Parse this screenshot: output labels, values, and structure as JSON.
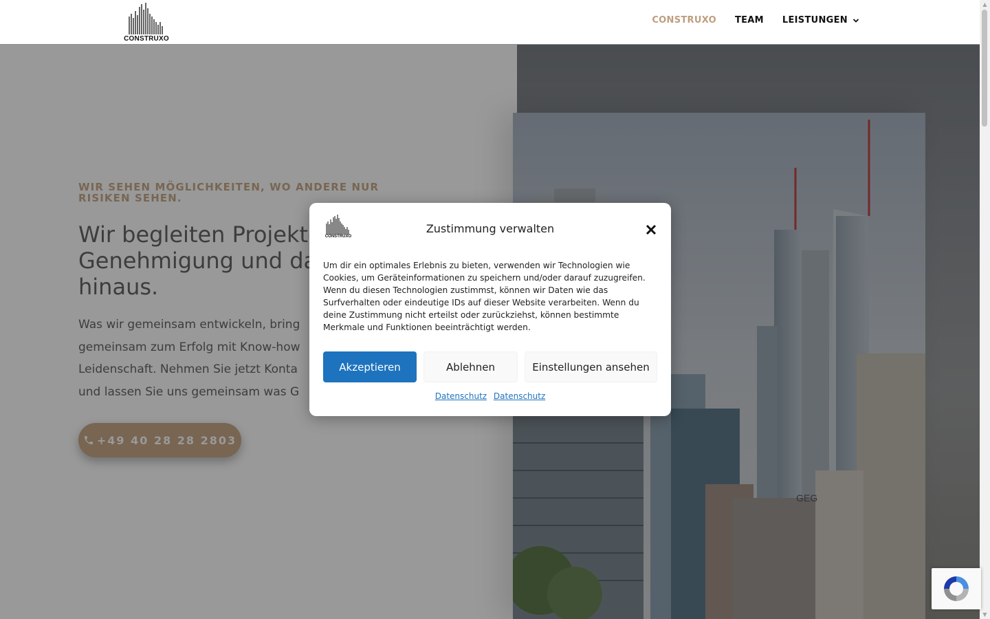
{
  "header": {
    "logo_text": "CONSTRUXO",
    "nav": [
      {
        "label": "CONSTRUXO",
        "active": true
      },
      {
        "label": "TEAM",
        "active": false
      },
      {
        "label": "LEISTUNGEN",
        "active": false,
        "has_dropdown": true
      }
    ]
  },
  "hero": {
    "tagline": "WIR SEHEN MÖGLICHKEITEN, WO ANDERE NUR RISIKEN SEHEN.",
    "headline_line1": "Wir begleiten Projekte",
    "headline_line2": "Genehmigung und da",
    "headline_line3": "hinaus.",
    "body_line1": "Was wir gemeinsam entwickeln, bring",
    "body_line2": "gemeinsam zum Erfolg  mit Know-how",
    "body_line3": "Leidenschaft. Nehmen Sie jetzt Konta",
    "body_line4": "und lassen Sie uns gemeinsam was G",
    "phone_label": "+49 40 28 28 2803",
    "phone_icon": "phone-icon"
  },
  "photo": {
    "sign_text": "GEG"
  },
  "consent": {
    "logo_text": "CONSTRUXO",
    "title": "Zustimmung verwalten",
    "text": "Um dir ein optimales Erlebnis zu bieten, verwenden wir Technologien wie Cookies, um Geräteinformationen zu speichern und/oder darauf zuzugreifen. Wenn du diesen Technologien zustimmst, können wir Daten wie das Surfverhalten oder eindeutige IDs auf dieser Website verarbeiten. Wenn du deine Zustimmung nicht erteilst oder zurückziehst, können bestimmte Merkmale und Funktionen beeinträchtigt werden.",
    "accept_label": "Akzeptieren",
    "deny_label": "Ablehnen",
    "settings_label": "Einstellungen ansehen",
    "links": [
      "Datenschutz",
      "Datenschutz"
    ],
    "accent_color": "#1e73be"
  },
  "colors": {
    "brand_gold": "#c8aa89",
    "nav_active": "#bd9e7f"
  }
}
